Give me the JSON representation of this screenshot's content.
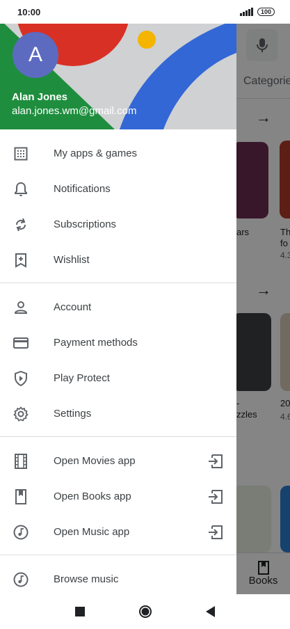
{
  "status_bar": {
    "time": "10:00",
    "battery": "100"
  },
  "drawer": {
    "user": {
      "initial": "A",
      "name": "Alan Jones",
      "email": "alan.jones.wm@gmail.com"
    },
    "section1": [
      {
        "label": "My apps & games",
        "icon": "grid-icon"
      },
      {
        "label": "Notifications",
        "icon": "bell-icon"
      },
      {
        "label": "Subscriptions",
        "icon": "refresh-icon"
      },
      {
        "label": "Wishlist",
        "icon": "bookmark-add-icon"
      }
    ],
    "section2": [
      {
        "label": "Account",
        "icon": "person-icon"
      },
      {
        "label": "Payment methods",
        "icon": "credit-card-icon"
      },
      {
        "label": "Play Protect",
        "icon": "shield-play-icon"
      },
      {
        "label": "Settings",
        "icon": "gear-icon"
      }
    ],
    "section3": [
      {
        "label": "Open Movies app",
        "icon": "film-icon"
      },
      {
        "label": "Open Books app",
        "icon": "book-icon"
      },
      {
        "label": "Open Music app",
        "icon": "music-icon"
      }
    ],
    "section4": [
      {
        "label": "Browse music",
        "icon": "music-icon"
      }
    ]
  },
  "background_app": {
    "tab_label": "Categorie",
    "tile1_title": "ars",
    "tile2_title": "Th",
    "tile2_sub": "fo",
    "tile2_rating": "4.3",
    "tile3_title": "-",
    "tile3_sub": "zzles",
    "tile4_title": "20",
    "tile4_rating": "4.6",
    "books_label": "Books"
  },
  "colors": {
    "accent_red": "#d93025",
    "accent_blue": "#3367d6",
    "accent_green": "#1e8e3e",
    "accent_yellow": "#f4b400",
    "avatar": "#5c6bc0"
  }
}
